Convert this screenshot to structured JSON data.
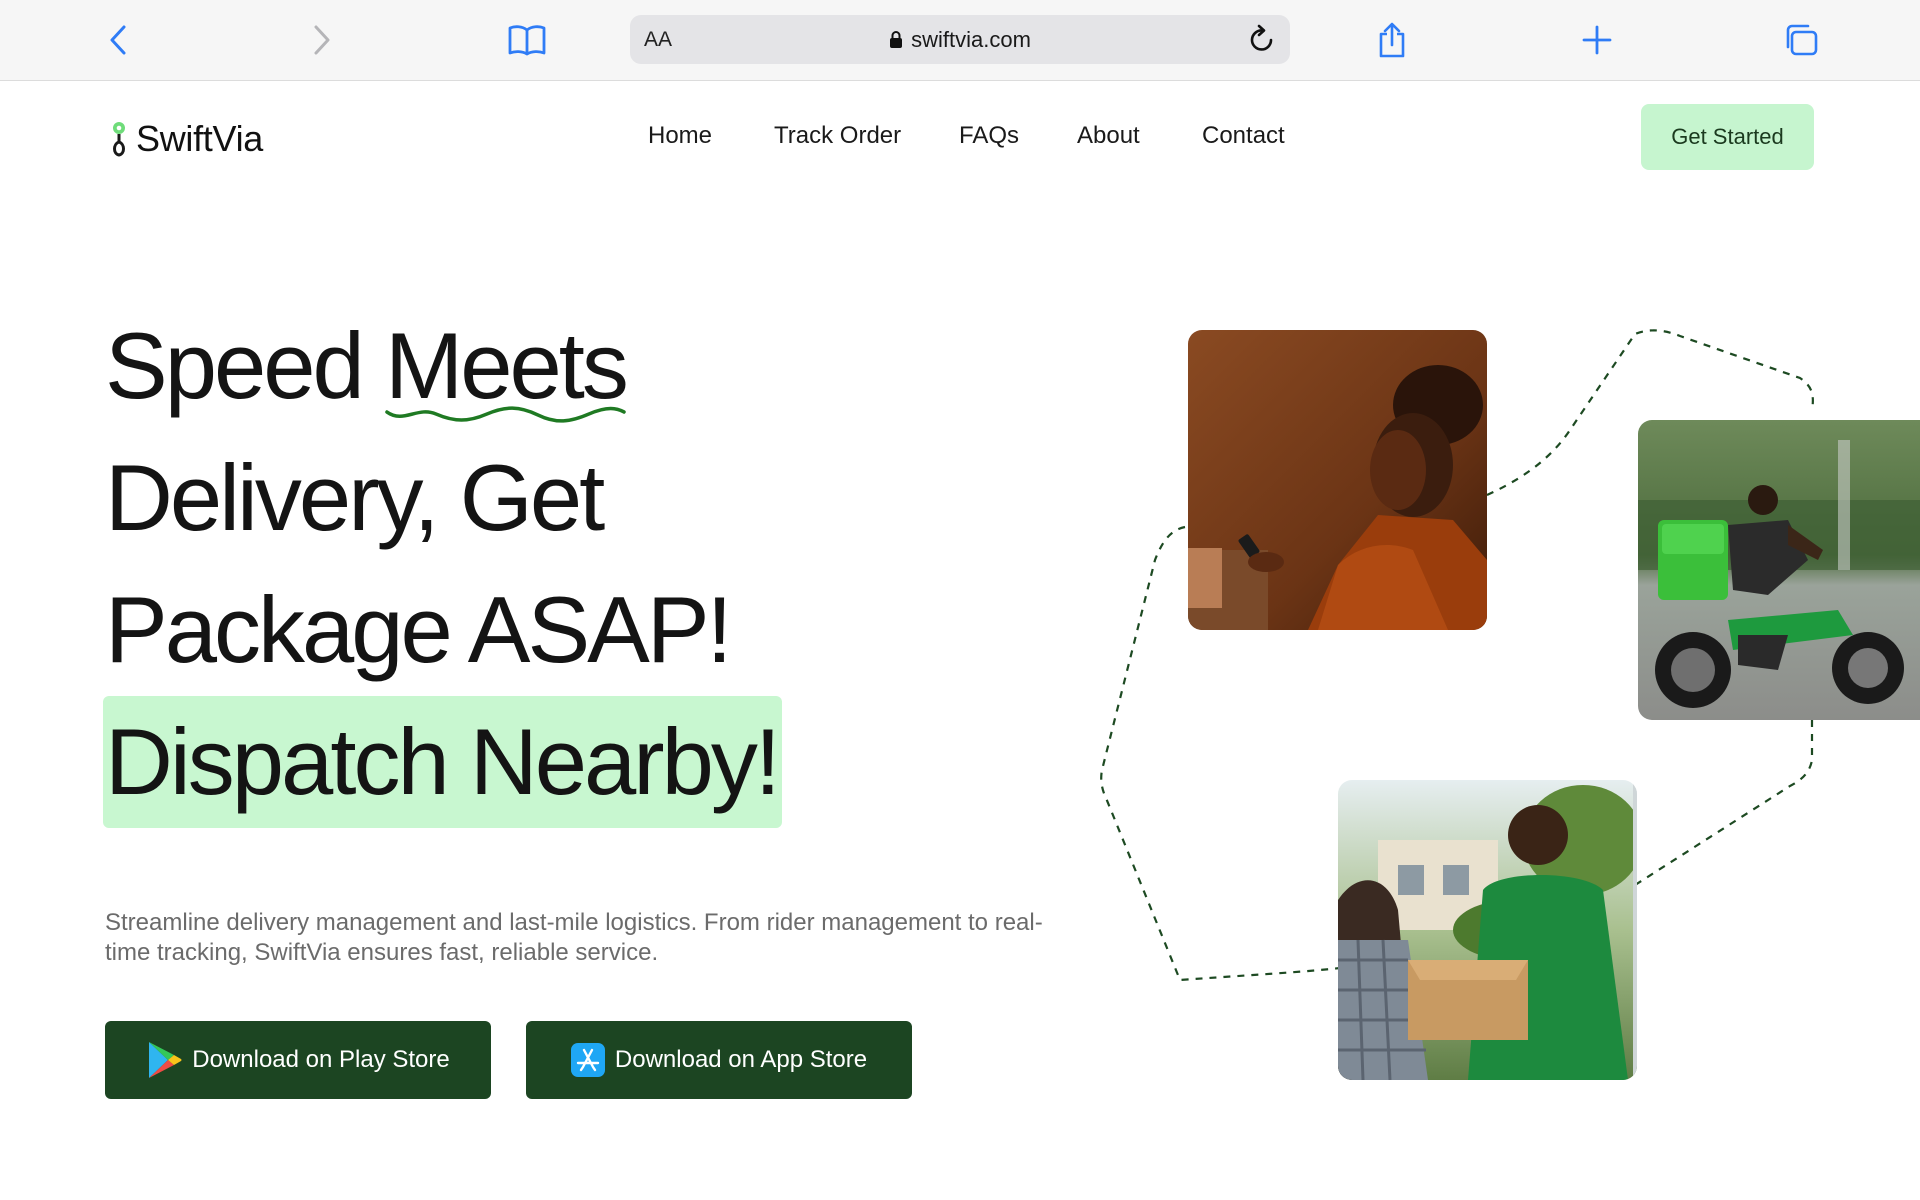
{
  "browser": {
    "aa_label": "AA",
    "url": "swiftvia.com",
    "icons": [
      "back-chevron-icon",
      "forward-chevron-icon",
      "book-icon",
      "lock-icon",
      "reload-icon",
      "share-icon",
      "plus-icon",
      "tabs-icon"
    ]
  },
  "nav": {
    "logo_text": "SwiftVia",
    "links": [
      "Home",
      "Track Order",
      "FAQs",
      "About",
      "Contact"
    ],
    "cta": "Get Started"
  },
  "hero": {
    "line1_a": "Speed",
    "line1_b": "Meets",
    "line2": "Delivery, Get",
    "line3": "Package ASAP!",
    "line4": "Dispatch Nearby!",
    "description": "Streamline delivery management and last-mile logistics. From rider management to real-time tracking, SwiftVia ensures fast, reliable service.",
    "play_store_label": "Download on Play Store",
    "app_store_label": "Download on App Store"
  },
  "colors": {
    "accent_green": "#1c4522",
    "highlight_green": "#c8f7d0",
    "squiggle_green": "#1f7a23",
    "cta_green": "#c6f5cf"
  }
}
